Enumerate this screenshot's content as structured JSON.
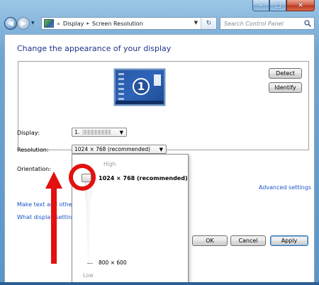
{
  "window": {
    "caption_buttons": {
      "minimize": "–",
      "maximize": "□",
      "close": "✕"
    }
  },
  "nav": {
    "back": "◀",
    "forward": "▶",
    "history_dropdown": "▼",
    "address": {
      "chevron": "«",
      "crumbs": [
        "Display",
        "Screen Resolution"
      ],
      "separator": "▸",
      "dropdown": "▼",
      "refresh": "↻"
    },
    "search_placeholder": "Search Control Panel"
  },
  "main": {
    "title": "Change the appearance of your display",
    "monitor_number": "1",
    "detect_label": "Detect",
    "identify_label": "Identify",
    "display_label": "Display:",
    "display_value": "1.",
    "resolution_label": "Resolution:",
    "resolution_value": "1024 × 768 (recommended)",
    "orientation_label": "Orientation:",
    "advanced_link": "Advanced settings",
    "make_text_link": "Make text and other items larger or smaller",
    "what_display_link": "What display settings should I choose?",
    "ok_label": "OK",
    "cancel_label": "Cancel",
    "apply_label": "Apply"
  },
  "resolution_popup": {
    "high_label": "High",
    "low_label": "Low",
    "top_option": "1024 × 768 (recommended)",
    "bottom_option": "800 × 600",
    "slider_level": "top"
  },
  "annotations": {
    "highlight_color": "#e31010"
  }
}
